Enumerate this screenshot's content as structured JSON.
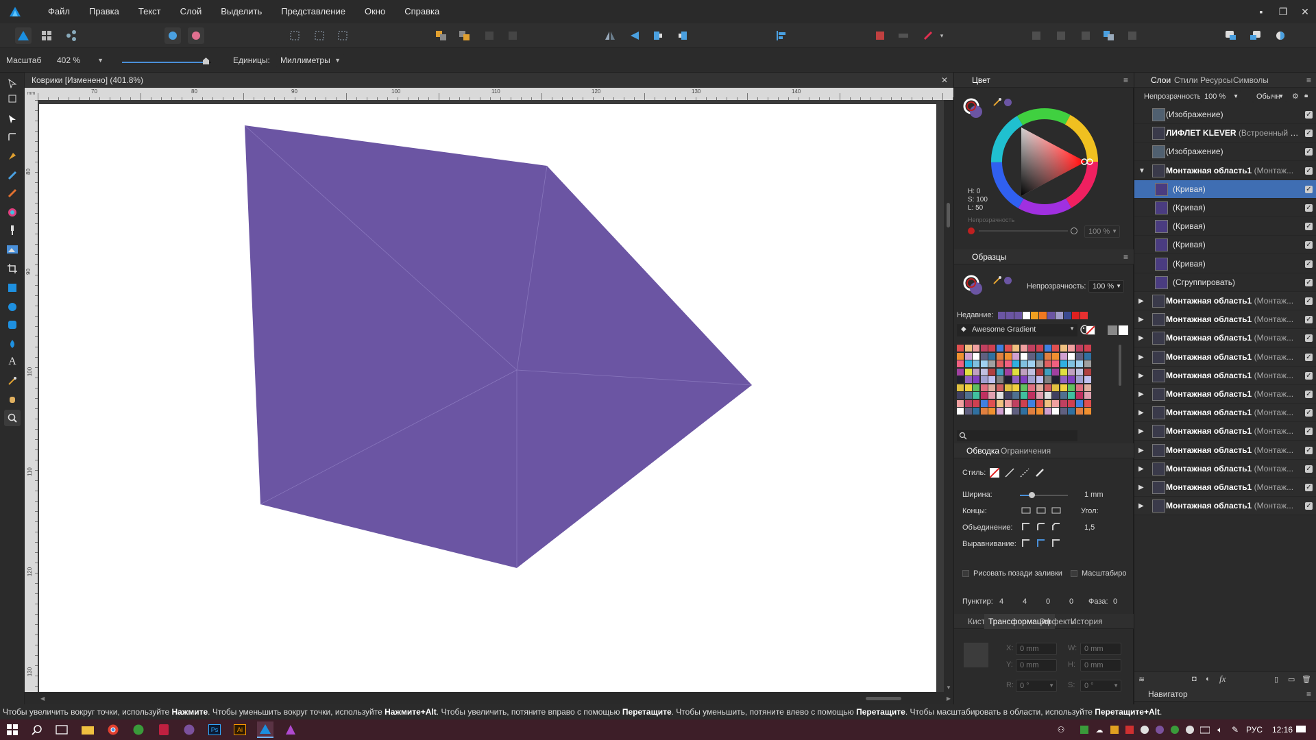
{
  "menu": {
    "items": [
      "Файл",
      "Правка",
      "Текст",
      "Слой",
      "Выделить",
      "Представление",
      "Окно",
      "Справка"
    ]
  },
  "window_controls": {
    "minimize": "▪",
    "restore": "❐",
    "close": "✕"
  },
  "context_bar": {
    "scale_label": "Масштаб",
    "scale_value": "402 %",
    "units_label": "Единицы:",
    "units_value": "Миллиметры"
  },
  "document": {
    "tab_title": "Коврики [Изменено] (401.8%)",
    "close": "✕",
    "ruler_h": [
      "70",
      "80",
      "90",
      "100",
      "110",
      "120",
      "130",
      "140"
    ],
    "ruler_v": [
      "80",
      "90",
      "100",
      "110",
      "120",
      "130"
    ],
    "shape_color": "#6b55a3"
  },
  "color_panel": {
    "title": "Цвет",
    "h": "H: 0",
    "s": "S: 100",
    "l": "L: 50",
    "opacity_label": "Непрозрачность",
    "opacity_value": "100 %"
  },
  "swatches_panel": {
    "title": "Образцы",
    "opacity_label": "Непрозрачность:",
    "opacity_value": "100 %",
    "recent_label": "Недавние:",
    "palette": "Awesome Gradient",
    "recent_colors": [
      "#6b55a3",
      "#6b55a3",
      "#6b55a3",
      "#ffffff",
      "#f0a020",
      "#f07820",
      "#6b55a3",
      "#a09cc8",
      "#3a4a90",
      "#e02020",
      "#e83030"
    ]
  },
  "stroke_panel": {
    "tabs": [
      "Обводка",
      "Ограничения"
    ],
    "style_label": "Стиль:",
    "width_label": "Ширина:",
    "width_value": "1 mm",
    "caps_label": "Концы:",
    "angle_label": "Угол:",
    "join_label": "Объединение:",
    "join_value": "1,5",
    "align_label": "Выравнивание:",
    "draw_behind": "Рисовать позади заливки",
    "scale": "Масштабиро",
    "dash_label": "Пунктир:",
    "dash_values": [
      "4",
      "4",
      "0",
      "0"
    ],
    "phase_label": "Фаза:",
    "phase_value": "0"
  },
  "transform_panel": {
    "tabs": [
      "Кисти",
      "Трансформация",
      "Эффекты",
      "История"
    ],
    "x_label": "X:",
    "x_value": "0 mm",
    "w_label": "W:",
    "w_value": "0 mm",
    "y_label": "Y:",
    "y_value": "0 mm",
    "h_label": "H:",
    "h_value": "0 mm",
    "r_label": "R:",
    "r_value": "0 °",
    "s_label": "S:",
    "s_value": "0 °"
  },
  "layers_panel": {
    "tabs": [
      "Слои",
      "Стили",
      "Ресурсы",
      "Символы"
    ],
    "opacity_label": "Непрозрачность:",
    "opacity_value": "100 %",
    "blend_value": "Обычн",
    "layers": [
      {
        "name": "(Изображение)",
        "type": "",
        "bold": false,
        "indent": 0,
        "expand": ""
      },
      {
        "name": "ЛИФЛЕТ KLEVER",
        "type": "(Встроенный д...",
        "bold": true,
        "indent": 0,
        "expand": ""
      },
      {
        "name": "(Изображение)",
        "type": "",
        "bold": false,
        "indent": 0,
        "expand": ""
      },
      {
        "name": "Монтажная область1",
        "type": "(Монтаж...",
        "bold": true,
        "indent": 0,
        "expand": "▼"
      },
      {
        "name": "(Кривая)",
        "type": "",
        "bold": false,
        "indent": 1,
        "expand": "",
        "selected": true
      },
      {
        "name": "(Кривая)",
        "type": "",
        "bold": false,
        "indent": 1,
        "expand": ""
      },
      {
        "name": "(Кривая)",
        "type": "",
        "bold": false,
        "indent": 1,
        "expand": ""
      },
      {
        "name": "(Кривая)",
        "type": "",
        "bold": false,
        "indent": 1,
        "expand": ""
      },
      {
        "name": "(Кривая)",
        "type": "",
        "bold": false,
        "indent": 1,
        "expand": ""
      },
      {
        "name": "(Сгруппировать)",
        "type": "",
        "bold": false,
        "indent": 1,
        "expand": ""
      },
      {
        "name": "Монтажная область1",
        "type": "(Монтаж...",
        "bold": true,
        "indent": 0,
        "expand": "▶"
      },
      {
        "name": "Монтажная область1",
        "type": "(Монтаж...",
        "bold": true,
        "indent": 0,
        "expand": "▶"
      },
      {
        "name": "Монтажная область1",
        "type": "(Монтаж...",
        "bold": true,
        "indent": 0,
        "expand": "▶"
      },
      {
        "name": "Монтажная область1",
        "type": "(Монтаж...",
        "bold": true,
        "indent": 0,
        "expand": "▶"
      },
      {
        "name": "Монтажная область1",
        "type": "(Монтаж...",
        "bold": true,
        "indent": 0,
        "expand": "▶"
      },
      {
        "name": "Монтажная область1",
        "type": "(Монтаж...",
        "bold": true,
        "indent": 0,
        "expand": "▶"
      },
      {
        "name": "Монтажная область1",
        "type": "(Монтаж...",
        "bold": true,
        "indent": 0,
        "expand": "▶"
      },
      {
        "name": "Монтажная область1",
        "type": "(Монтаж...",
        "bold": true,
        "indent": 0,
        "expand": "▶"
      },
      {
        "name": "Монтажная область1",
        "type": "(Монтаж...",
        "bold": true,
        "indent": 0,
        "expand": "▶"
      },
      {
        "name": "Монтажная область1",
        "type": "(Монтаж...",
        "bold": true,
        "indent": 0,
        "expand": "▶"
      },
      {
        "name": "Монтажная область1",
        "type": "(Монтаж...",
        "bold": true,
        "indent": 0,
        "expand": "▶"
      },
      {
        "name": "Монтажная область1",
        "type": "(Монтаж...",
        "bold": true,
        "indent": 0,
        "expand": "▶"
      }
    ],
    "navigator": "Навигатор"
  },
  "status": {
    "parts": [
      {
        "t": "Чтобы увеличить вокруг точки, используйте ",
        "b": false
      },
      {
        "t": "Нажмите",
        "b": true
      },
      {
        "t": ". Чтобы уменьшить вокруг точки, используйте ",
        "b": false
      },
      {
        "t": "Нажмите+Alt",
        "b": true
      },
      {
        "t": ". Чтобы увеличить, потяните вправо с помощью ",
        "b": false
      },
      {
        "t": "Перетащите",
        "b": true
      },
      {
        "t": ". Чтобы уменьшить, потяните влево с помощью ",
        "b": false
      },
      {
        "t": "Перетащите",
        "b": true
      },
      {
        "t": ". Чтобы масштабировать в области, используйте ",
        "b": false
      },
      {
        "t": "Перетащите+Alt",
        "b": true
      },
      {
        "t": ".",
        "b": false
      }
    ]
  },
  "taskbar": {
    "lang": "РУС",
    "time": "12:16"
  }
}
